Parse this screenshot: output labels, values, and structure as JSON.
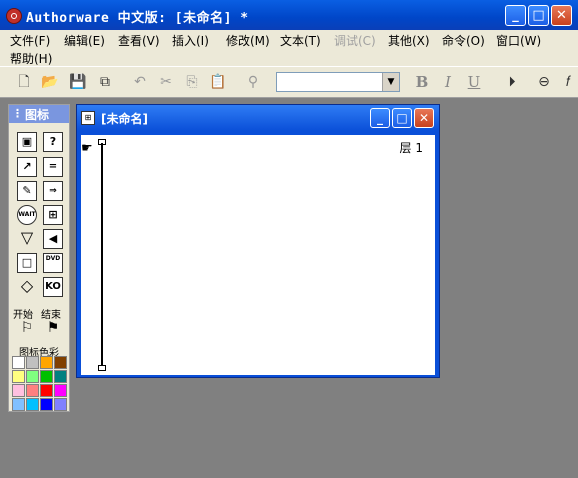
{
  "window": {
    "title": "Authorware 中文版: [未命名] *"
  },
  "menu": [
    {
      "label": "文件(F)",
      "enabled": true
    },
    {
      "label": "编辑(E)",
      "enabled": true
    },
    {
      "label": "查看(V)",
      "enabled": true
    },
    {
      "label": "插入(I)",
      "enabled": true
    },
    {
      "label": "修改(M)",
      "enabled": true
    },
    {
      "label": "文本(T)",
      "enabled": true
    },
    {
      "label": "调试(C)",
      "enabled": false
    },
    {
      "label": "其他(X)",
      "enabled": true
    },
    {
      "label": "命令(O)",
      "enabled": true
    },
    {
      "label": "窗口(W)",
      "enabled": true
    },
    {
      "label": "帮助(H)",
      "enabled": true
    }
  ],
  "toolbar": {
    "buttons": [
      "new-icon",
      "open-icon",
      "save-all-icon",
      "import-icon",
      "undo-icon",
      "cut-icon",
      "copy-icon",
      "paste-icon",
      "find-icon",
      "bold-icon",
      "italic-icon",
      "underline-icon",
      "run-icon",
      "control-panel-icon",
      "functions-icon"
    ],
    "style_combo_value": "",
    "bold": "B",
    "italic": "I",
    "underline": "U"
  },
  "palette": {
    "title": "图标",
    "start_label": "开始",
    "end_label": "结束",
    "colors_label": "图标色彩",
    "icon_wait_label": "WAIT",
    "icon_kd_label": "KO",
    "icon_dvd_label": "DVD",
    "swatches": [
      "#ffffff",
      "#c0c0c0",
      "#ffa500",
      "#804000",
      "#ffff80",
      "#80ff80",
      "#00c000",
      "#008080",
      "#ffc0e0",
      "#ff8080",
      "#ff0000",
      "#ff00ff",
      "#80c0ff",
      "#00c0ff",
      "#0000ff",
      "#8080ff"
    ]
  },
  "document": {
    "title": "[未命名]",
    "level_label": "层 1"
  }
}
